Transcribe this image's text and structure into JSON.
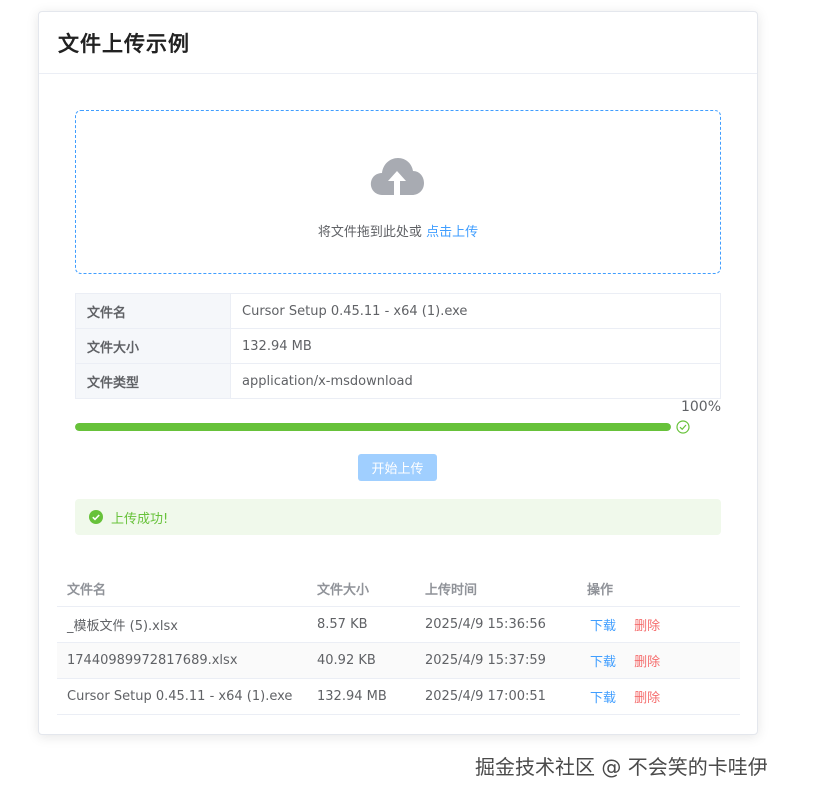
{
  "card": {
    "title": "文件上传示例"
  },
  "dropzone": {
    "icon": "upload-cloud-icon",
    "text": "将文件拖到此处或",
    "link": "点击上传",
    "border_color": "#409eff"
  },
  "file_info": {
    "rows": [
      {
        "label": "文件名",
        "value": "Cursor Setup 0.45.11 - x64 (1).exe"
      },
      {
        "label": "文件大小",
        "value": "132.94 MB"
      },
      {
        "label": "文件类型",
        "value": "application/x-msdownload"
      }
    ]
  },
  "progress": {
    "percent_label": "100%",
    "value": 1.0,
    "color": "#67c23a",
    "status_icon": "success-circle-icon"
  },
  "start_button": {
    "label": "开始上传",
    "disabled": true
  },
  "alert": {
    "text": "上传成功!",
    "type": "success",
    "icon": "success-filled-icon",
    "color": "#67c23a"
  },
  "file_table": {
    "headers": [
      "文件名",
      "文件大小",
      "上传时间",
      "操作"
    ],
    "rows": [
      {
        "name": "_模板文件 (5).xlsx",
        "size": "8.57 KB",
        "time": "2025/4/9 15:36:56",
        "download": "下载",
        "delete": "删除"
      },
      {
        "name": "17440989972817689.xlsx",
        "size": "40.92 KB",
        "time": "2025/4/9 15:37:59",
        "download": "下载",
        "delete": "删除"
      },
      {
        "name": "Cursor Setup 0.45.11 - x64 (1).exe",
        "size": "132.94 MB",
        "time": "2025/4/9 17:00:51",
        "download": "下载",
        "delete": "删除"
      }
    ]
  },
  "colors": {
    "primary": "#409eff",
    "success": "#67c23a",
    "danger": "#f56c6c"
  },
  "watermark": "掘金技术社区 @ 不会笑的卡哇伊"
}
